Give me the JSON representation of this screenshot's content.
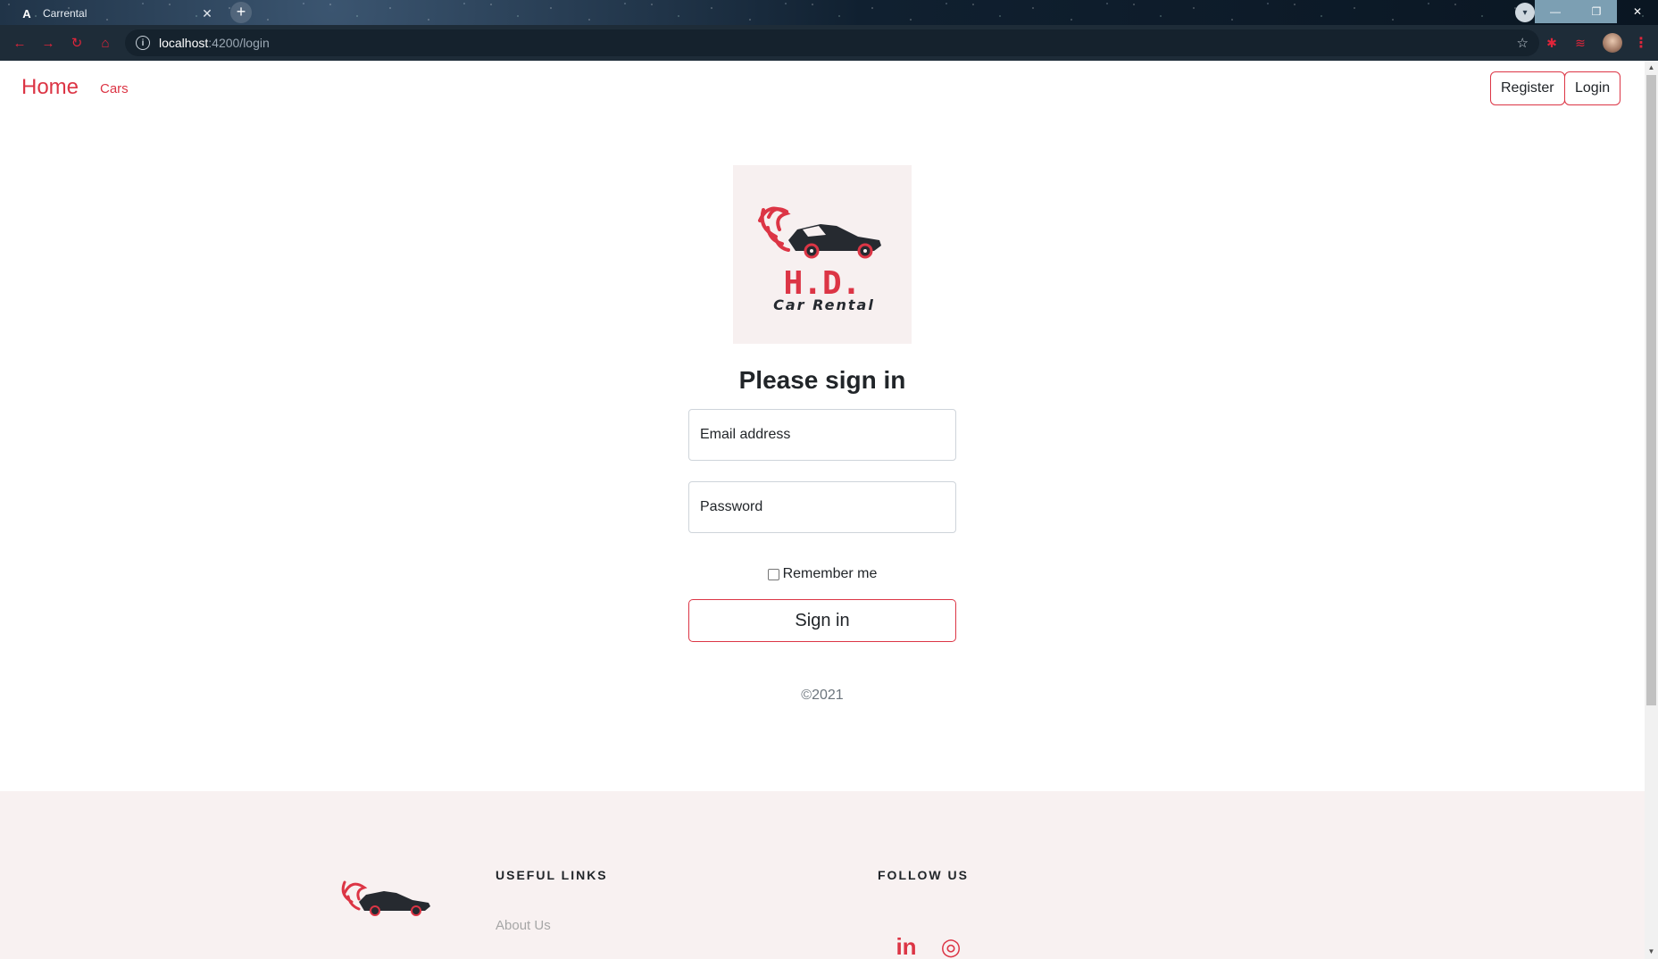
{
  "browser": {
    "tab_title": "Carrental",
    "tab_logo": "A",
    "tab_close": "✕",
    "new_tab": "+",
    "url_host": "localhost",
    "url_path": ":4200/login",
    "controls": {
      "minimize": "—",
      "maximize": "❐",
      "close": "✕"
    }
  },
  "navbar": {
    "brand": "Home",
    "links": [
      {
        "label": "Cars"
      }
    ],
    "register_label": "Register",
    "login_label": "Login"
  },
  "logo": {
    "title": "H.D.",
    "subtitle": "Car Rental",
    "colors": {
      "accent": "#dc3545",
      "dark": "#262a30"
    }
  },
  "signin": {
    "heading": "Please sign in",
    "email_placeholder": "Email address",
    "password_placeholder": "Password",
    "remember_label": "Remember me",
    "button_label": "Sign in",
    "copyright": "©2021"
  },
  "footer": {
    "useful_links_heading": "USEFUL LINKS",
    "follow_us_heading": "FOLLOW US",
    "links": [
      {
        "label": "About Us"
      }
    ],
    "social": [
      {
        "name": "linkedin-icon",
        "glyph": "in"
      },
      {
        "name": "instagram-icon",
        "glyph": "◎"
      }
    ]
  },
  "theme": {
    "accent": "#dc3545",
    "text": "#212529",
    "muted": "#6c757d",
    "footer_bg": "#f8f1f1"
  }
}
